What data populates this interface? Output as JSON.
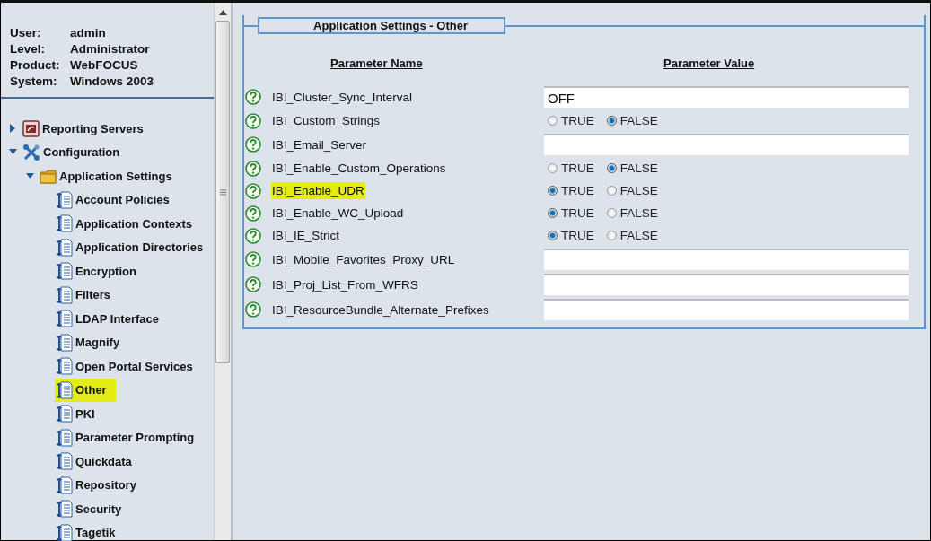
{
  "user_info": [
    {
      "label": "User:",
      "value": "admin"
    },
    {
      "label": "Level:",
      "value": "Administrator"
    },
    {
      "label": "Product:",
      "value": "WebFOCUS"
    },
    {
      "label": "System:",
      "value": "Windows 2003"
    }
  ],
  "tree": [
    {
      "label": "Reporting Servers",
      "kind": "server",
      "expanded": false,
      "selected": false
    },
    {
      "label": "Configuration",
      "kind": "tools",
      "expanded": true,
      "selected": false,
      "children": [
        {
          "label": "Application Settings",
          "kind": "folder",
          "expanded": true,
          "selected": false,
          "children": [
            {
              "label": "Account Policies",
              "kind": "setting",
              "selected": false
            },
            {
              "label": "Application Contexts",
              "kind": "setting",
              "selected": false
            },
            {
              "label": "Application Directories",
              "kind": "setting",
              "selected": false
            },
            {
              "label": "Encryption",
              "kind": "setting",
              "selected": false
            },
            {
              "label": "Filters",
              "kind": "setting",
              "selected": false
            },
            {
              "label": "LDAP Interface",
              "kind": "setting",
              "selected": false
            },
            {
              "label": "Magnify",
              "kind": "setting",
              "selected": false
            },
            {
              "label": "Open Portal Services",
              "kind": "setting",
              "selected": false
            },
            {
              "label": "Other",
              "kind": "setting",
              "selected": true
            },
            {
              "label": "PKI",
              "kind": "setting",
              "selected": false
            },
            {
              "label": "Parameter Prompting",
              "kind": "setting",
              "selected": false
            },
            {
              "label": "Quickdata",
              "kind": "setting",
              "selected": false
            },
            {
              "label": "Repository",
              "kind": "setting",
              "selected": false
            },
            {
              "label": "Security",
              "kind": "setting",
              "selected": false
            },
            {
              "label": "Tagetik",
              "kind": "setting",
              "selected": false
            }
          ]
        }
      ]
    }
  ],
  "panel": {
    "title": "Application Settings - Other",
    "columns": [
      "Parameter Name",
      "Parameter Value"
    ],
    "rows": [
      {
        "name": "IBI_Cluster_Sync_Interval",
        "highlighted": false,
        "kind": "text",
        "value": "OFF"
      },
      {
        "name": "IBI_Custom_Strings",
        "highlighted": false,
        "kind": "radio",
        "options": [
          {
            "label": "TRUE",
            "selected": false
          },
          {
            "label": "FALSE",
            "selected": true
          }
        ]
      },
      {
        "name": "IBI_Email_Server",
        "highlighted": false,
        "kind": "text"
      },
      {
        "name": "IBI_Enable_Custom_Operations",
        "highlighted": false,
        "kind": "radio",
        "options": [
          {
            "label": "TRUE",
            "selected": false
          },
          {
            "label": "FALSE",
            "selected": true
          }
        ]
      },
      {
        "name": "IBI_Enable_UDR",
        "highlighted": true,
        "kind": "radio",
        "options": [
          {
            "label": "TRUE",
            "selected": true
          },
          {
            "label": "FALSE",
            "selected": false
          }
        ]
      },
      {
        "name": "IBI_Enable_WC_Upload",
        "highlighted": false,
        "kind": "radio",
        "options": [
          {
            "label": "TRUE",
            "selected": true
          },
          {
            "label": "FALSE",
            "selected": false
          }
        ]
      },
      {
        "name": "IBI_IE_Strict",
        "highlighted": false,
        "kind": "radio",
        "options": [
          {
            "label": "TRUE",
            "selected": true
          },
          {
            "label": "FALSE",
            "selected": false
          }
        ]
      },
      {
        "name": "IBI_Mobile_Favorites_Proxy_URL",
        "highlighted": false,
        "kind": "text"
      },
      {
        "name": "IBI_Proj_List_From_WFRS",
        "highlighted": false,
        "kind": "text"
      },
      {
        "name": "IBI_ResourceBundle_Alternate_Prefixes",
        "highlighted": false,
        "kind": "text"
      }
    ]
  }
}
